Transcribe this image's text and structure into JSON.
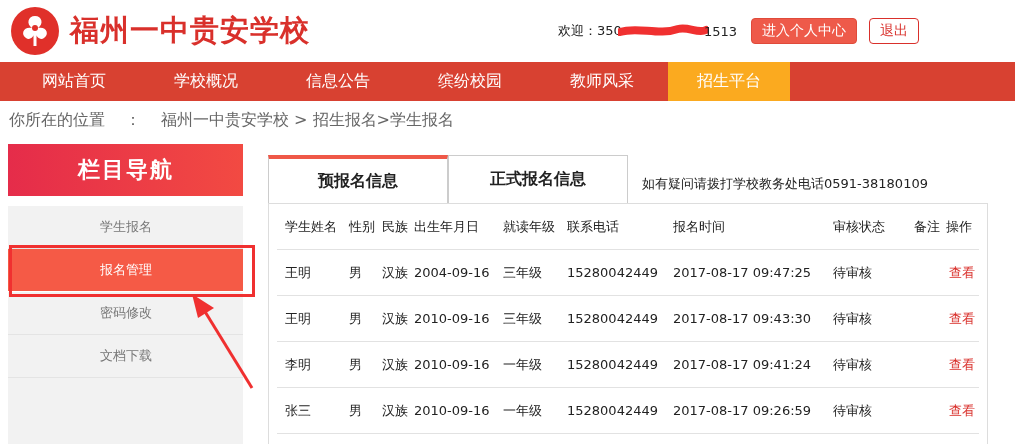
{
  "header": {
    "school_name": "福州一中贵安学校",
    "welcome_label": "欢迎：",
    "user_id_start": "350",
    "user_id_end": "1513",
    "user_id_redacted": true,
    "buttons": [
      {
        "label": "进入个人中心",
        "kind": "primary"
      },
      {
        "label": "退出",
        "kind": "outline"
      }
    ]
  },
  "nav": [
    {
      "label": "网站首页",
      "selected": false
    },
    {
      "label": "学校概况",
      "selected": false
    },
    {
      "label": "信息公告",
      "selected": false
    },
    {
      "label": "缤纷校园",
      "selected": false
    },
    {
      "label": "教师风采",
      "selected": false
    },
    {
      "label": "招生平台",
      "selected": true
    }
  ],
  "breadcrumb": {
    "label": "你所在的位置",
    "separator": "：",
    "path": "福州一中贵安学校 > 招生报名>学生报名"
  },
  "sidebar": {
    "title": "栏目导航",
    "items": [
      {
        "label": "学生报名",
        "selected": false
      },
      {
        "label": "报名管理",
        "selected": true
      },
      {
        "label": "密码修改",
        "selected": false
      },
      {
        "label": "文档下载",
        "selected": false
      }
    ]
  },
  "tabs": [
    {
      "label": "预报名信息",
      "selected": true
    },
    {
      "label": "正式报名信息",
      "selected": false
    }
  ],
  "contact_note": "如有疑问请拨打学校教务处电话0591-38180109",
  "table": {
    "columns": [
      "学生姓名",
      "性别",
      "民族",
      "出生年月日",
      "就读年级",
      "联系电话",
      "报名时间",
      "审核状态",
      "备注",
      "操作"
    ],
    "rows": [
      {
        "name": "王明",
        "gender": "男",
        "ethnicity": "汉族",
        "birth_date": "2004-09-16",
        "grade": "三年级",
        "phone": "15280042449",
        "registered_at": "2017-08-17 09:47:25",
        "status": "待审核",
        "action": "查看"
      },
      {
        "name": "王明",
        "gender": "男",
        "ethnicity": "汉族",
        "birth_date": "2010-09-16",
        "grade": "三年级",
        "phone": "15280042449",
        "registered_at": "2017-08-17 09:43:30",
        "status": "待审核",
        "action": "查看"
      },
      {
        "name": "李明",
        "gender": "男",
        "ethnicity": "汉族",
        "birth_date": "2010-09-16",
        "grade": "一年级",
        "phone": "15280042449",
        "registered_at": "2017-08-17 09:41:24",
        "status": "待审核",
        "action": "查看"
      },
      {
        "name": "张三",
        "gender": "男",
        "ethnicity": "汉族",
        "birth_date": "2010-09-16",
        "grade": "一年级",
        "phone": "15280042449",
        "registered_at": "2017-08-17 09:26:59",
        "status": "待审核",
        "action": "查看"
      }
    ]
  }
}
